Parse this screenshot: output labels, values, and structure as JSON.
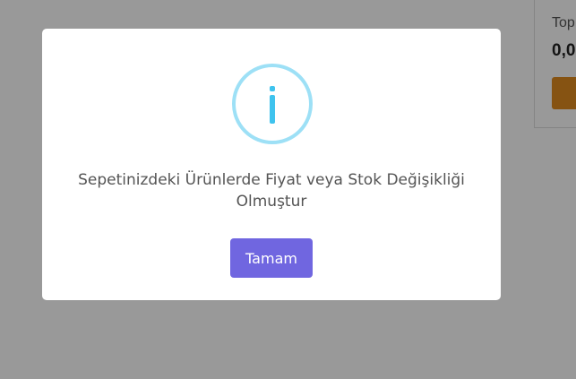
{
  "cart_summary": {
    "total_label": "Top",
    "total_value": "0,0"
  },
  "modal": {
    "icon": "info-icon",
    "message": "Sepetinizdeki Ürünlerde Fiyat veya Stok Değişikliği Olmuştur",
    "confirm_label": "Tamam",
    "colors": {
      "confirm_button": "#7066e0",
      "icon_ring": "#9de0f6",
      "icon_glyph": "#3fc3ee"
    }
  }
}
